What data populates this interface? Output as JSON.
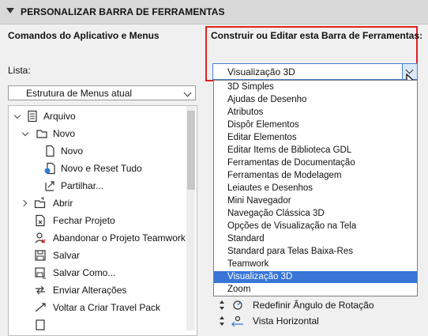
{
  "section": {
    "title": "PERSONALIZAR BARRA DE FERRAMENTAS"
  },
  "left": {
    "heading": "Comandos do Aplicativo e Menus",
    "list_label": "Lista:",
    "list_value": "Estrutura de Menus atual",
    "tree": [
      {
        "label": "Arquivo",
        "icon": "document-icon"
      },
      {
        "label": "Novo",
        "icon": "folder-icon"
      },
      {
        "label": "Novo",
        "icon": "new-file-icon"
      },
      {
        "label": "Novo e Reset Tudo",
        "icon": "new-reset-icon"
      },
      {
        "label": "Partilhar...",
        "icon": "share-icon"
      },
      {
        "label": "Abrir",
        "icon": "open-folder-icon"
      },
      {
        "label": "Fechar Projeto",
        "icon": "close-project-icon"
      },
      {
        "label": "Abandonar o Projeto Teamwork",
        "icon": "teamwork-leave-icon"
      },
      {
        "label": "Salvar",
        "icon": "save-icon"
      },
      {
        "label": "Salvar Como...",
        "icon": "save-as-icon"
      },
      {
        "label": "Enviar Alterações",
        "icon": "send-changes-icon"
      },
      {
        "label": "Voltar a Criar Travel Pack",
        "icon": "travel-pack-icon"
      }
    ]
  },
  "right": {
    "heading": "Construir ou Editar esta Barra de Ferramentas:",
    "selected": "Visualização 3D",
    "options": [
      "3D Simples",
      "Ajudas de Desenho",
      "Atributos",
      "Dispôr Elementos",
      "Editar Elementos",
      "Editar Items de Biblioteca GDL",
      "Ferramentas de Documentação",
      "Ferramentas de Modelagem",
      "Leiautes e Desenhos",
      "Mini Navegador",
      "Navegação Clássica 3D",
      "Opções de Visualização na Tela",
      "Standard",
      "Standard para Telas Baixa-Res",
      "Teamwork",
      "Visualização 3D",
      "Zoom"
    ],
    "below": [
      {
        "label": "Redefinir Ângulo de Rotação",
        "icon": "rotation-angle-icon"
      },
      {
        "label": "Vista Horizontal",
        "icon": "horizontal-view-icon"
      }
    ]
  },
  "colors": {
    "highlight": "#e0231f",
    "selection": "#3875d7"
  }
}
